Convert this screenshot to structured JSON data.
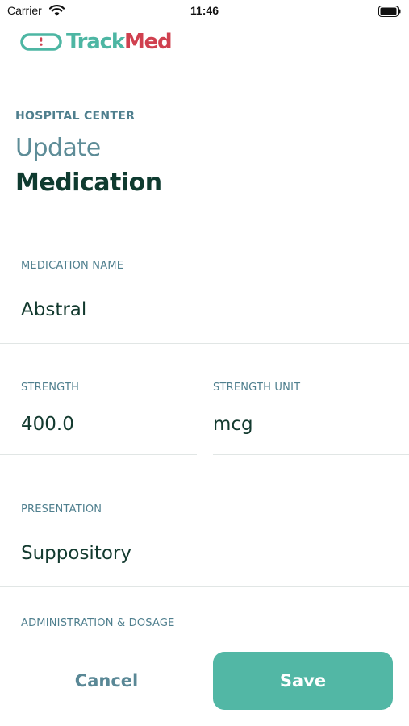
{
  "status_bar": {
    "carrier": "Carrier",
    "time": "11:46",
    "icons": [
      "wifi-icon",
      "battery-icon"
    ]
  },
  "brand": {
    "logo_icon": "capsule-icon",
    "name_part1": "Track",
    "name_part2": "Med",
    "colors": {
      "primary": "#4db6a3",
      "secondary": "#d0404f"
    }
  },
  "header": {
    "eyebrow": "HOSPITAL CENTER",
    "title_light": "Update",
    "title_bold": "Medication"
  },
  "form": {
    "medication_name": {
      "label": "MEDICATION NAME",
      "value": "Abstral"
    },
    "strength": {
      "label": "STRENGTH",
      "value": "400.0"
    },
    "strength_unit": {
      "label": "STRENGTH UNIT",
      "value": "mcg"
    },
    "presentation": {
      "label": "PRESENTATION",
      "value": "Suppository"
    },
    "administration_dosage": {
      "label": "ADMINISTRATION & DOSAGE"
    }
  },
  "actions": {
    "cancel_label": "Cancel",
    "save_label": "Save",
    "colors": {
      "save_bg": "#52b7a5",
      "cancel_text": "#5a8896"
    }
  }
}
